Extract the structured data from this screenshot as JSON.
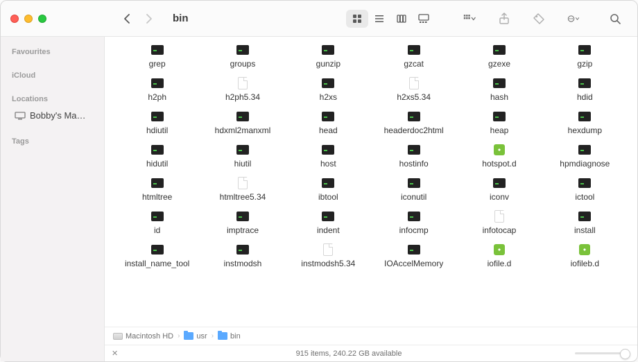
{
  "title": "bin",
  "sidebar": {
    "sections": [
      {
        "label": "Favourites"
      },
      {
        "label": "iCloud"
      },
      {
        "label": "Locations",
        "items": [
          {
            "label": "Bobby's Ma…",
            "icon": "desktop"
          }
        ]
      },
      {
        "label": "Tags"
      }
    ]
  },
  "files": [
    {
      "name": "grep",
      "type": "exec"
    },
    {
      "name": "groups",
      "type": "exec"
    },
    {
      "name": "gunzip",
      "type": "exec"
    },
    {
      "name": "gzcat",
      "type": "exec"
    },
    {
      "name": "gzexe",
      "type": "exec"
    },
    {
      "name": "gzip",
      "type": "exec"
    },
    {
      "name": "h2ph",
      "type": "exec"
    },
    {
      "name": "h2ph5.34",
      "type": "doc"
    },
    {
      "name": "h2xs",
      "type": "exec"
    },
    {
      "name": "h2xs5.34",
      "type": "doc"
    },
    {
      "name": "hash",
      "type": "exec"
    },
    {
      "name": "hdid",
      "type": "exec"
    },
    {
      "name": "hdiutil",
      "type": "exec"
    },
    {
      "name": "hdxml2manxml",
      "type": "exec"
    },
    {
      "name": "head",
      "type": "exec"
    },
    {
      "name": "headerdoc2html",
      "type": "exec"
    },
    {
      "name": "heap",
      "type": "exec"
    },
    {
      "name": "hexdump",
      "type": "exec"
    },
    {
      "name": "hidutil",
      "type": "exec"
    },
    {
      "name": "hiutil",
      "type": "exec"
    },
    {
      "name": "host",
      "type": "exec"
    },
    {
      "name": "hostinfo",
      "type": "exec"
    },
    {
      "name": "hotspot.d",
      "type": "green"
    },
    {
      "name": "hpmdiagnose",
      "type": "exec"
    },
    {
      "name": "htmltree",
      "type": "exec"
    },
    {
      "name": "htmltree5.34",
      "type": "doc"
    },
    {
      "name": "ibtool",
      "type": "exec"
    },
    {
      "name": "iconutil",
      "type": "exec"
    },
    {
      "name": "iconv",
      "type": "exec"
    },
    {
      "name": "ictool",
      "type": "exec"
    },
    {
      "name": "id",
      "type": "exec"
    },
    {
      "name": "imptrace",
      "type": "exec"
    },
    {
      "name": "indent",
      "type": "exec"
    },
    {
      "name": "infocmp",
      "type": "exec"
    },
    {
      "name": "infotocap",
      "type": "doc"
    },
    {
      "name": "install",
      "type": "exec"
    },
    {
      "name": "install_name_tool",
      "type": "exec"
    },
    {
      "name": "instmodsh",
      "type": "exec"
    },
    {
      "name": "instmodsh5.34",
      "type": "doc"
    },
    {
      "name": "IOAccelMemory",
      "type": "exec"
    },
    {
      "name": "iofile.d",
      "type": "green"
    },
    {
      "name": "iofileb.d",
      "type": "green"
    }
  ],
  "path": [
    {
      "label": "Macintosh HD",
      "icon": "hd"
    },
    {
      "label": "usr",
      "icon": "folder"
    },
    {
      "label": "bin",
      "icon": "folder"
    }
  ],
  "status": "915 items, 240.22 GB available"
}
